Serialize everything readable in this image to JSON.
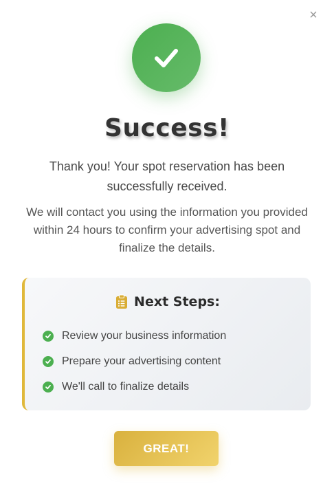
{
  "modal": {
    "close_symbol": "×",
    "title": "Success!",
    "lead_text": "Thank you! Your spot reservation has been successfully received.",
    "info_text": "We will contact you using the information you provided within 24 hours to confirm your advertising spot and finalize the details."
  },
  "next_steps": {
    "icon": "clipboard-list-icon",
    "title": "Next Steps:",
    "items": [
      {
        "label": "Review your business information"
      },
      {
        "label": "Prepare your advertising content"
      },
      {
        "label": "We'll call to finalize details"
      }
    ]
  },
  "actions": {
    "confirm_label": "GREAT!"
  },
  "colors": {
    "success_green": "#4caf50",
    "accent_gold": "#e0b83a",
    "title_text": "#333333"
  }
}
